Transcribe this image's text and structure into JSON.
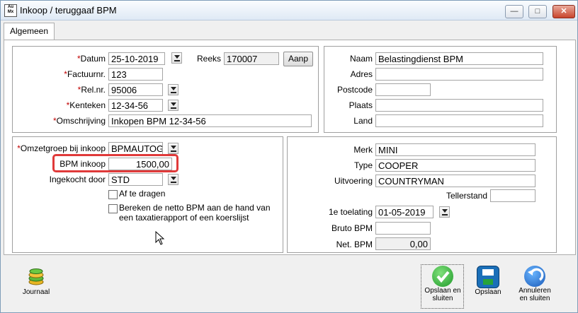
{
  "window": {
    "title": "Inkoop / teruggaaf BPM",
    "app_icon_text": "Auto\nMix"
  },
  "tabs": [
    {
      "label": "Algemeen",
      "active": true
    }
  ],
  "left_top": {
    "datum": {
      "label": "Datum",
      "value": "25-10-2019",
      "required": true
    },
    "reeks": {
      "label": "Reeks",
      "value": "170007"
    },
    "aanp_button": "Aanp",
    "factuurnr": {
      "label": "Factuurnr.",
      "value": "123",
      "required": true
    },
    "relnr": {
      "label": "Rel.nr.",
      "value": "95006",
      "required": true
    },
    "kenteken": {
      "label": "Kenteken",
      "value": "12-34-56",
      "required": true
    },
    "omschrijving": {
      "label": "Omschrijving",
      "value": "Inkopen BPM 12-34-56",
      "required": true
    }
  },
  "right_top": {
    "naam": {
      "label": "Naam",
      "value": "Belastingdienst BPM"
    },
    "adres": {
      "label": "Adres",
      "value": ""
    },
    "postcode": {
      "label": "Postcode",
      "value": ""
    },
    "plaats": {
      "label": "Plaats",
      "value": ""
    },
    "land": {
      "label": "Land",
      "value": ""
    }
  },
  "left_bottom": {
    "omzetgroep": {
      "label": "Omzetgroep bij inkoop",
      "value": "BPMAUTOGE",
      "required": true
    },
    "bpm_inkoop": {
      "label": "BPM inkoop",
      "value": "1500,00"
    },
    "ingekocht_door": {
      "label": "Ingekocht door",
      "value": "STD"
    },
    "af_te_dragen": {
      "label": "Af te dragen",
      "checked": false
    },
    "bereken": {
      "label_line1": "Bereken de netto BPM aan de hand van",
      "label_line2": "een taxatierapport of een koerslijst",
      "checked": false
    }
  },
  "right_bottom": {
    "merk": {
      "label": "Merk",
      "value": "MINI"
    },
    "type": {
      "label": "Type",
      "value": "COOPER"
    },
    "uitvoering": {
      "label": "Uitvoering",
      "value": "COUNTRYMAN"
    },
    "tellerstand": {
      "label": "Tellerstand",
      "value": ""
    },
    "eerste_toelating": {
      "label": "1e toelating",
      "value": "01-05-2019"
    },
    "bruto_bpm": {
      "label": "Bruto BPM",
      "value": ""
    },
    "net_bpm": {
      "label": "Net. BPM",
      "value": "0,00"
    }
  },
  "footer": {
    "journaal": "Journaal",
    "opslaan_sluiten_1": "Opslaan en",
    "opslaan_sluiten_2": "sluiten",
    "opslaan": "Opslaan",
    "annuleren_1": "Annuleren",
    "annuleren_2": "en sluiten"
  }
}
